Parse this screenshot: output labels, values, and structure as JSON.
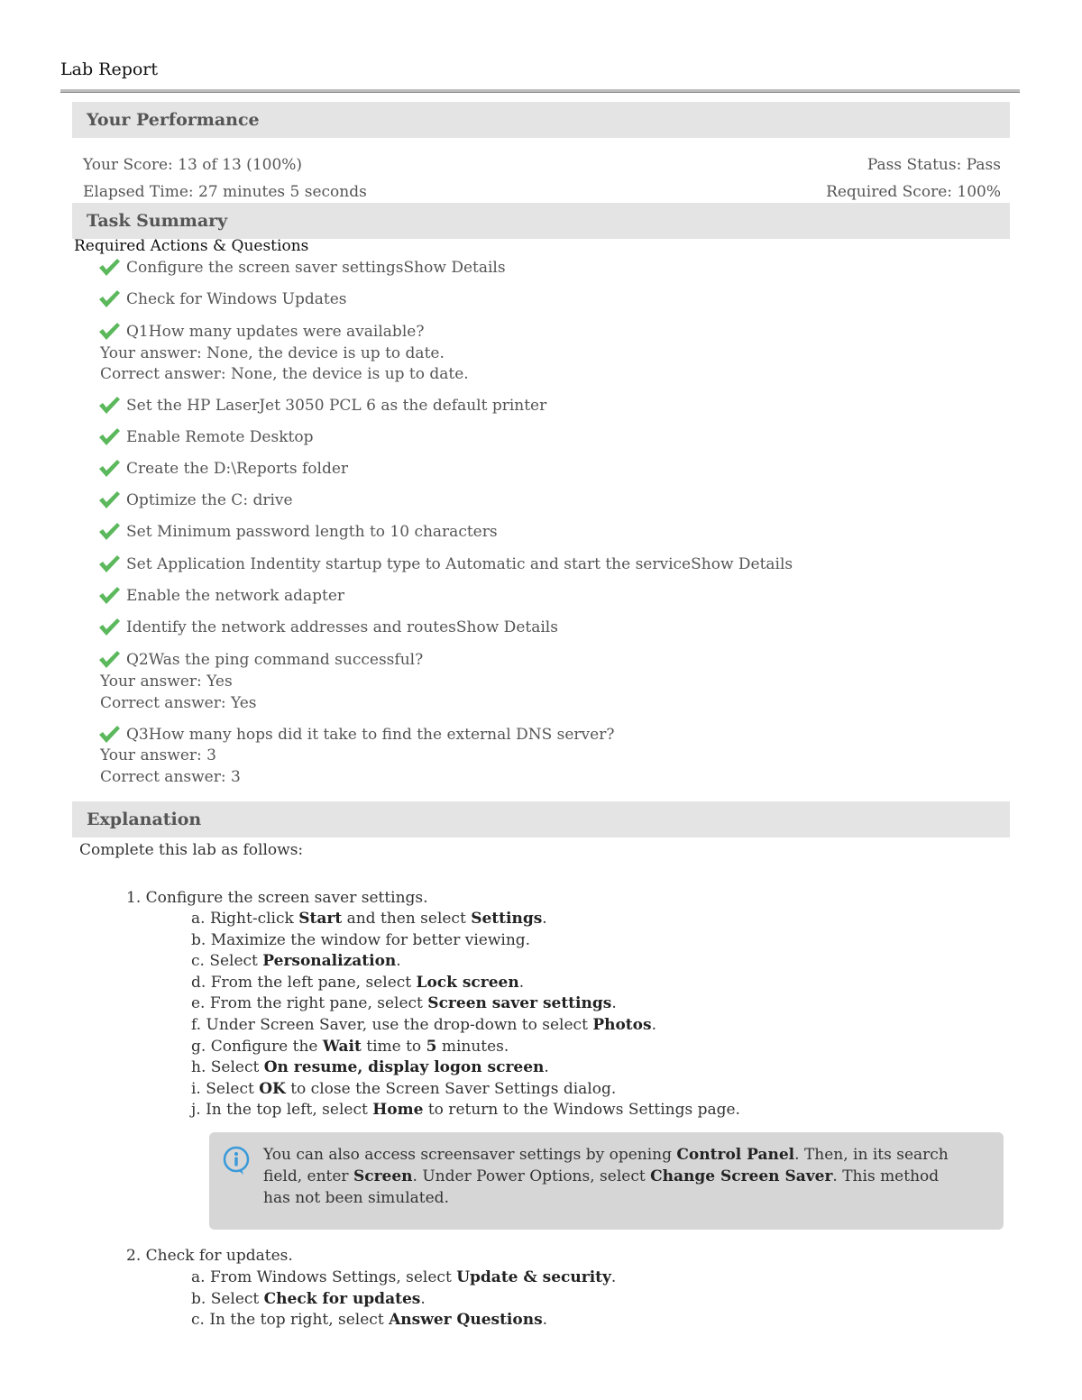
{
  "header": {
    "title": "Lab Report"
  },
  "performance": {
    "heading": "Your Performance",
    "score": "Your Score: 13 of 13 (100%)",
    "pass_status": "Pass Status: Pass",
    "elapsed": "Elapsed Time: 27 minutes 5 seconds",
    "required_score": "Required Score: 100%"
  },
  "task_summary": {
    "heading": "Task Summary",
    "subheading": "Required Actions & Questions",
    "tasks": [
      "Configure the screen saver settingsShow Details",
      "Check for Windows Updates",
      "Q1How many updates were available?",
      "Set the HP LaserJet 3050 PCL 6 as the default printer",
      "Enable Remote Desktop",
      "Create the D:\\Reports folder",
      "Optimize the C: drive",
      "Set Minimum password length to 10 characters",
      "Set Application Indentity startup type to Automatic and start the serviceShow Details",
      "Enable the network adapter",
      "Identify the network addresses and routesShow Details",
      "Q2Was the ping command successful?",
      "Q3How many hops did it take to find the external DNS server?"
    ],
    "answers": {
      "q1_yours": "Your answer: None, the device is up to date.",
      "q1_correct": "Correct answer: None, the device is up to date.",
      "q2_yours": "Your answer: Yes",
      "q2_correct": "Correct answer: Yes",
      "q3_yours": "Your answer: 3",
      "q3_correct": "Correct answer: 3"
    },
    "check_color": "#5cb85c"
  },
  "explanation": {
    "heading": "Explanation",
    "intro": "Complete this lab as follows:",
    "step1": "1. Configure the screen saver settings.",
    "step1_subs": [
      [
        "a. Right-click ",
        "Start",
        " and then select ",
        "Settings",
        "."
      ],
      [
        "b. Maximize the window for better viewing."
      ],
      [
        "c. Select ",
        "Personalization",
        "."
      ],
      [
        "d. From the left pane, select ",
        "Lock screen",
        "."
      ],
      [
        "e. From the right pane, select ",
        "Screen saver settings",
        "."
      ],
      [
        "f. Under Screen Saver, use the drop-down to select ",
        "Photos",
        "."
      ],
      [
        "g. Configure the ",
        "Wait",
        " time to ",
        "5",
        " minutes."
      ],
      [
        "h. Select ",
        "On resume, display logon screen",
        "."
      ],
      [
        "i. Select ",
        "OK",
        " to close the Screen Saver Settings dialog."
      ],
      [
        "j. In the top left, select ",
        "Home",
        " to return to the Windows Settings page."
      ]
    ],
    "note": [
      "You can also access screensaver settings by opening ",
      "Control Panel",
      ". Then, in its search field, enter ",
      "Screen",
      ". Under Power Options, select ",
      "Change Screen Saver",
      ". This method has not been simulated."
    ],
    "step2": "2. Check for updates.",
    "step2_subs": [
      [
        "a. From Windows Settings, select ",
        "Update & security",
        "."
      ],
      [
        "b. Select ",
        "Check for updates",
        "."
      ],
      [
        "c. In the top right, select ",
        "Answer Questions",
        "."
      ]
    ],
    "info_color": "#3a9ad9"
  }
}
